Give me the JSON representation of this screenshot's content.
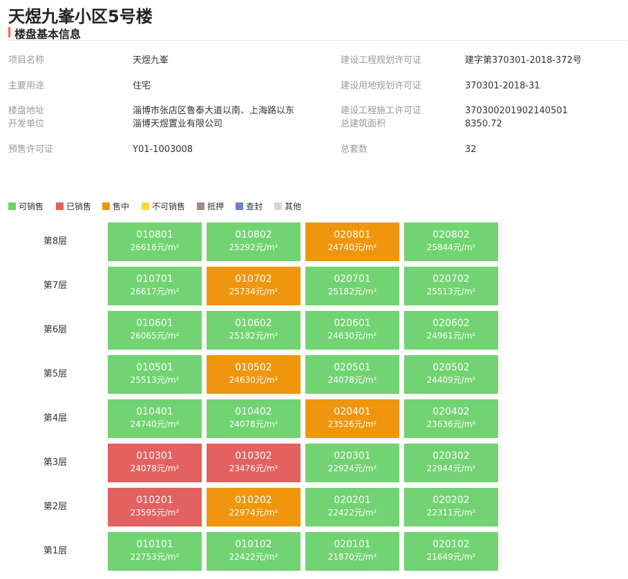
{
  "page": {
    "title": "天煜九峯小区5号楼"
  },
  "section": {
    "title": "楼盘基本信息"
  },
  "info": {
    "project_name_label": "项目名称",
    "project_name": "天煜九峯",
    "planning_permit_label": "建设工程规划许可证",
    "planning_permit": "建字第370301-2018-372号",
    "usage_label": "主要用途",
    "usage": "住宅",
    "land_permit_label": "建设用地规划许可证",
    "land_permit": "370301-2018-31",
    "address_label": "楼盘地址",
    "address": "淄博市张店区鲁泰大道以南、上海路以东",
    "construction_permit_label": "建设工程施工许可证",
    "construction_permit": "370300201902140501",
    "developer_label": "开发单位",
    "developer": "淄博天煜置业有限公司",
    "floor_area_label": "总建筑面积",
    "floor_area": "8350.72",
    "presale_label": "预售许可证",
    "presale": "Y01-1003008",
    "total_units_label": "总套数",
    "total_units": "32"
  },
  "legend": [
    {
      "label": "可销售",
      "color": "#72d372"
    },
    {
      "label": "已销售",
      "color": "#e36161"
    },
    {
      "label": "售中",
      "color": "#ef960e"
    },
    {
      "label": "不可销售",
      "color": "#fbd545"
    },
    {
      "label": "抵押",
      "color": "#a38a82"
    },
    {
      "label": "查封",
      "color": "#6b83cc"
    },
    {
      "label": "其他",
      "color": "#d6d6d6"
    }
  ],
  "floors": [
    {
      "label": "第8层",
      "units": [
        {
          "no": "010801",
          "price": "26616元/m²",
          "status": "可销售"
        },
        {
          "no": "010802",
          "price": "25292元/m²",
          "status": "可销售"
        },
        {
          "no": "020801",
          "price": "24740元/m²",
          "status": "售中"
        },
        {
          "no": "020802",
          "price": "25844元/m²",
          "status": "可销售"
        }
      ]
    },
    {
      "label": "第7层",
      "units": [
        {
          "no": "010701",
          "price": "26617元/m²",
          "status": "可销售"
        },
        {
          "no": "010702",
          "price": "25734元/m²",
          "status": "售中"
        },
        {
          "no": "020701",
          "price": "25182元/m²",
          "status": "可销售"
        },
        {
          "no": "020702",
          "price": "25513元/m²",
          "status": "可销售"
        }
      ]
    },
    {
      "label": "第6层",
      "units": [
        {
          "no": "010601",
          "price": "26065元/m²",
          "status": "可销售"
        },
        {
          "no": "010602",
          "price": "25182元/m²",
          "status": "可销售"
        },
        {
          "no": "020601",
          "price": "24630元/m²",
          "status": "可销售"
        },
        {
          "no": "020602",
          "price": "24961元/m²",
          "status": "可销售"
        }
      ]
    },
    {
      "label": "第5层",
      "units": [
        {
          "no": "010501",
          "price": "25513元/m²",
          "status": "可销售"
        },
        {
          "no": "010502",
          "price": "24630元/m²",
          "status": "售中"
        },
        {
          "no": "020501",
          "price": "24078元/m²",
          "status": "可销售"
        },
        {
          "no": "020502",
          "price": "24409元/m²",
          "status": "可销售"
        }
      ]
    },
    {
      "label": "第4层",
      "units": [
        {
          "no": "010401",
          "price": "24740元/m²",
          "status": "可销售"
        },
        {
          "no": "010402",
          "price": "24078元/m²",
          "status": "可销售"
        },
        {
          "no": "020401",
          "price": "23526元/m²",
          "status": "售中"
        },
        {
          "no": "020402",
          "price": "23636元/m²",
          "status": "可销售"
        }
      ]
    },
    {
      "label": "第3层",
      "units": [
        {
          "no": "010301",
          "price": "24078元/m²",
          "status": "已销售"
        },
        {
          "no": "010302",
          "price": "23476元/m²",
          "status": "已销售"
        },
        {
          "no": "020301",
          "price": "22924元/m²",
          "status": "可销售"
        },
        {
          "no": "020302",
          "price": "22944元/m²",
          "status": "可销售"
        }
      ]
    },
    {
      "label": "第2层",
      "units": [
        {
          "no": "010201",
          "price": "23595元/m²",
          "status": "已销售"
        },
        {
          "no": "010202",
          "price": "22974元/m²",
          "status": "售中"
        },
        {
          "no": "020201",
          "price": "22422元/m²",
          "status": "可销售"
        },
        {
          "no": "020202",
          "price": "22311元/m²",
          "status": "可销售"
        }
      ]
    },
    {
      "label": "第1层",
      "units": [
        {
          "no": "010101",
          "price": "22753元/m²",
          "status": "可销售"
        },
        {
          "no": "010102",
          "price": "22422元/m²",
          "status": "可销售"
        },
        {
          "no": "020101",
          "price": "21870元/m²",
          "status": "可销售"
        },
        {
          "no": "020102",
          "price": "21649元/m²",
          "status": "可销售"
        }
      ]
    }
  ]
}
